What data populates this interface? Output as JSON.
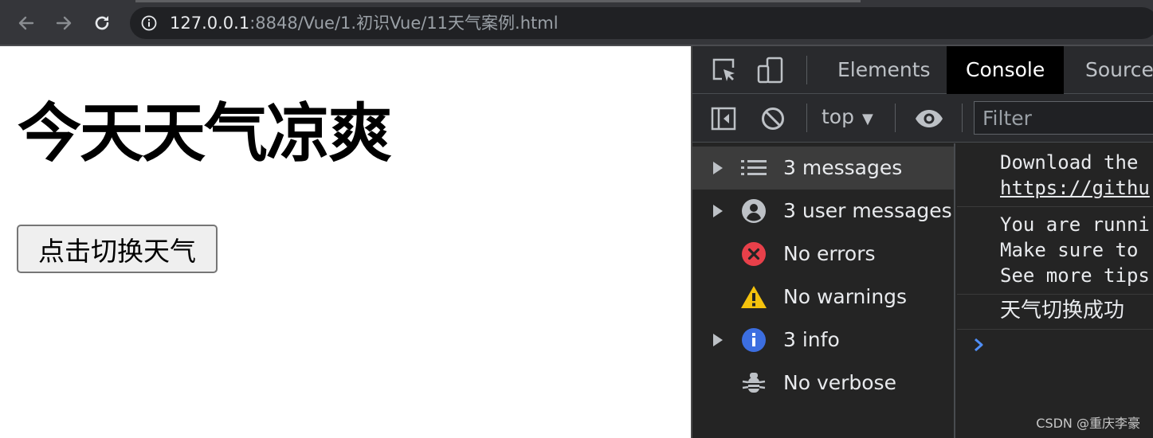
{
  "browser": {
    "url_host": "127.0.0.1",
    "url_path": ":8848/Vue/1.初识Vue/11天气案例.html",
    "icons": [
      "back-icon",
      "forward-icon",
      "reload-icon",
      "info-icon"
    ]
  },
  "page": {
    "heading": "今天天气凉爽",
    "button_label": "点击切换天气"
  },
  "devtools": {
    "tabs": [
      {
        "label": "Elements",
        "active": false
      },
      {
        "label": "Console",
        "active": true
      },
      {
        "label": "Sources",
        "active": false
      }
    ],
    "context": "top",
    "filter_placeholder": "Filter",
    "sidebar": [
      {
        "label": "3 messages",
        "icon": "list-icon",
        "expandable": true,
        "selected": true
      },
      {
        "label": "3 user messages",
        "icon": "user-icon",
        "expandable": true,
        "selected": false
      },
      {
        "label": "No errors",
        "icon": "error-icon",
        "expandable": false,
        "selected": false
      },
      {
        "label": "No warnings",
        "icon": "warning-icon",
        "expandable": false,
        "selected": false
      },
      {
        "label": "3 info",
        "icon": "info-icon",
        "expandable": true,
        "selected": false
      },
      {
        "label": "No verbose",
        "icon": "bug-icon",
        "expandable": false,
        "selected": false
      }
    ],
    "messages": [
      {
        "lines": [
          "Download the",
          "https://githu"
        ]
      },
      {
        "lines": [
          "You are runni",
          "Make sure to",
          "See more tips"
        ]
      },
      {
        "lines": [
          "天气切换成功"
        ]
      }
    ]
  },
  "watermark": "CSDN @重庆李豪",
  "colors": {
    "error": "#e8404a",
    "warning": "#f4c20d",
    "info": "#3c6ee0",
    "prompt": "#4f8ef7"
  }
}
